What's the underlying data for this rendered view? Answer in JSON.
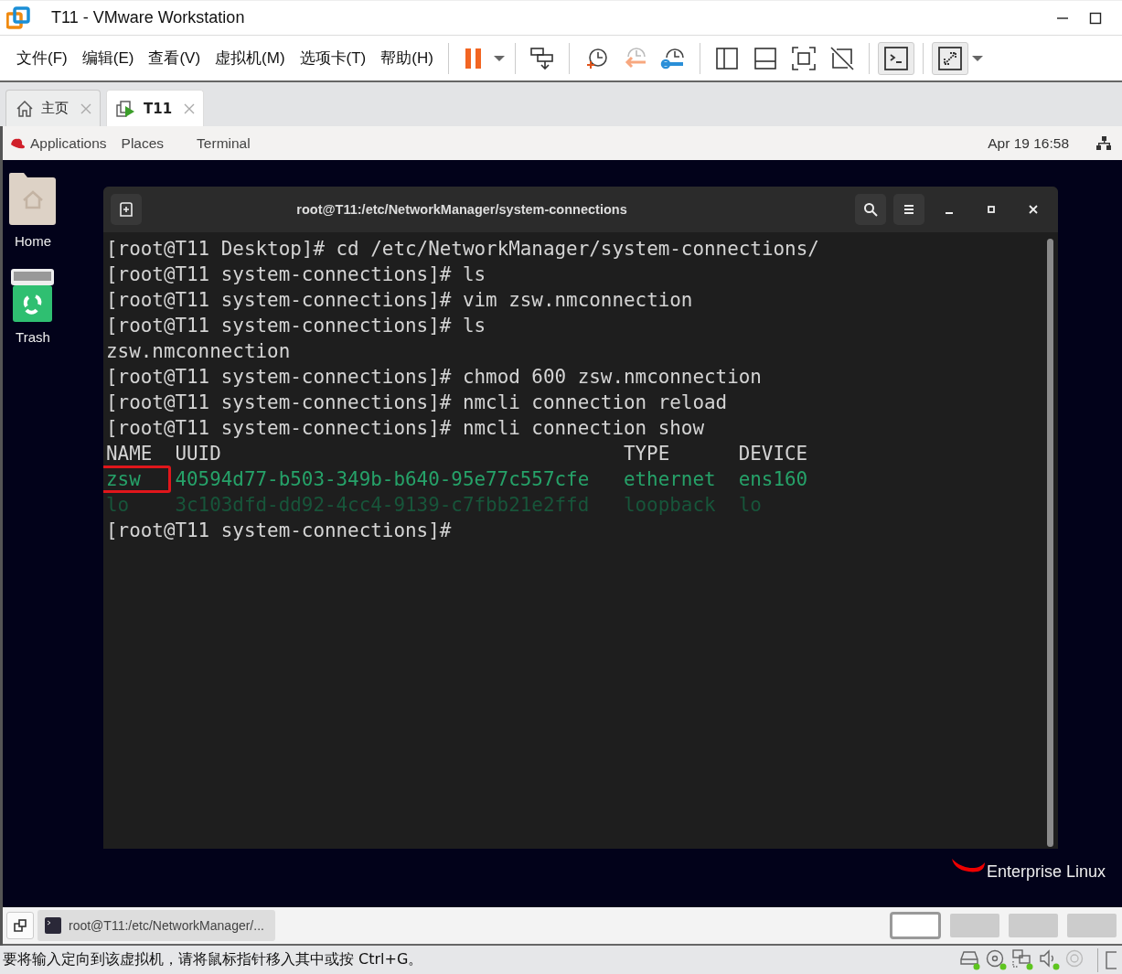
{
  "window": {
    "title": "T11 - VMware Workstation"
  },
  "menu": [
    "文件(F)",
    "编辑(E)",
    "查看(V)",
    "虚拟机(M)",
    "选项卡(T)",
    "帮助(H)"
  ],
  "toolbar": {
    "buttons": [
      {
        "pressed": false
      },
      {
        "pressed": false
      },
      {
        "pressed": false
      },
      {
        "pressed": false
      },
      {
        "pressed": false
      },
      {
        "pressed": false
      },
      {
        "pressed": false
      },
      {
        "pressed": false
      },
      {
        "pressed": false
      },
      {
        "pressed": true
      },
      {
        "pressed": true
      }
    ]
  },
  "tabs": [
    {
      "label": "主页",
      "selected": false
    },
    {
      "label": "T11",
      "selected": true
    }
  ],
  "gnome_bar": {
    "items": [
      "Applications",
      "Places",
      "Terminal"
    ],
    "clock": "Apr 19  16:58"
  },
  "desktop": {
    "icons": [
      {
        "kind": "home",
        "label": "Home"
      },
      {
        "kind": "trash",
        "label": "Trash"
      }
    ],
    "brand": "Enterprise Linux"
  },
  "terminal": {
    "title": "root@T11:/etc/NetworkManager/system-connections",
    "lines": [
      {
        "kind": "plain",
        "text": "[root@T11 Desktop]# cd /etc/NetworkManager/system-connections/"
      },
      {
        "kind": "plain",
        "text": "[root@T11 system-connections]# ls"
      },
      {
        "kind": "plain",
        "text": "[root@T11 system-connections]# vim zsw.nmconnection"
      },
      {
        "kind": "plain",
        "text": "[root@T11 system-connections]# ls"
      },
      {
        "kind": "plain",
        "text": "zsw.nmconnection"
      },
      {
        "kind": "plain",
        "text": "[root@T11 system-connections]# chmod 600 zsw.nmconnection"
      },
      {
        "kind": "plain",
        "text": "[root@T11 system-connections]# nmcli connection reload"
      },
      {
        "kind": "plain",
        "text": "[root@T11 system-connections]# nmcli connection show"
      },
      {
        "kind": "header",
        "cells": [
          "NAME",
          "UUID",
          "TYPE",
          "DEVICE"
        ]
      },
      {
        "kind": "row",
        "active": true,
        "marked": true,
        "cells": [
          "zsw",
          "40594d77-b503-349b-b640-95e77c557cfe",
          "ethernet",
          "ens160"
        ]
      },
      {
        "kind": "row",
        "active": false,
        "marked": false,
        "cells": [
          "lo",
          "3c103dfd-dd92-4cc4-9139-c7fbb21e2ffd",
          "loopback",
          "lo"
        ]
      },
      {
        "kind": "plain",
        "text": "[root@T11 system-connections]#"
      }
    ]
  },
  "taskbar": {
    "windows": [
      {
        "label": "root@T11:/etc/NetworkManager/..."
      }
    ],
    "thumbnails": [
      {
        "selected": true
      },
      {
        "selected": false
      },
      {
        "selected": false
      },
      {
        "selected": false
      }
    ]
  },
  "status_bar": {
    "text": "要将输入定向到该虚拟机，请将鼠标指针移入其中或按 Ctrl+G。",
    "devices": [
      {
        "connected": true
      },
      {
        "connected": true
      },
      {
        "connected": true
      },
      {
        "connected": true
      },
      {
        "connected": false
      }
    ]
  }
}
